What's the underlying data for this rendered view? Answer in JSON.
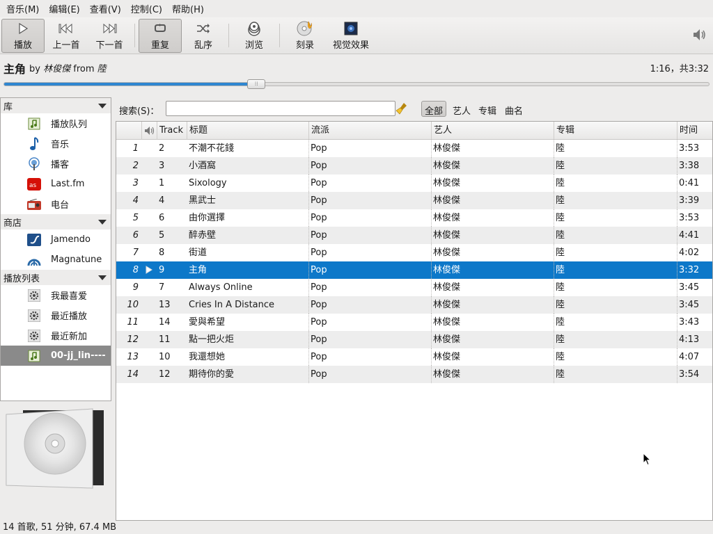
{
  "menu": [
    "音乐(M)",
    "编辑(E)",
    "查看(V)",
    "控制(C)",
    "帮助(H)"
  ],
  "toolbar": {
    "play": "播放",
    "prev": "上一首",
    "next": "下一首",
    "repeat": "重复",
    "shuffle": "乱序",
    "browse": "浏览",
    "burn": "刻录",
    "visual": "视觉效果"
  },
  "now_playing": {
    "title": "主角",
    "by_word": "by",
    "artist": "林俊傑",
    "from_word": "from",
    "album": "陸",
    "time": "1:16，共3:32",
    "progress_fraction": 0.358
  },
  "sidebar": {
    "sections": [
      {
        "header": "库",
        "items": [
          {
            "label": "播放队列",
            "icon": "play-queue-icon"
          },
          {
            "label": "音乐",
            "icon": "music-note-icon"
          },
          {
            "label": "播客",
            "icon": "podcast-icon"
          },
          {
            "label": "Last.fm",
            "icon": "lastfm-icon"
          },
          {
            "label": "电台",
            "icon": "radio-icon"
          }
        ]
      },
      {
        "header": "商店",
        "items": [
          {
            "label": "Jamendo",
            "icon": "jamendo-icon"
          },
          {
            "label": "Magnatune",
            "icon": "magnatune-icon"
          }
        ]
      },
      {
        "header": "播放列表",
        "items": [
          {
            "label": "我最喜爱",
            "icon": "gear-icon"
          },
          {
            "label": "最近播放",
            "icon": "gear-icon"
          },
          {
            "label": "最近新加",
            "icon": "gear-icon"
          },
          {
            "label": "00-jj_lin----",
            "icon": "playlist-icon",
            "selected": true
          }
        ]
      }
    ]
  },
  "search": {
    "label": "搜索(S)：",
    "value": "",
    "filters": [
      "全部",
      "艺人",
      "专辑",
      "曲名"
    ],
    "active_filter": "全部"
  },
  "table": {
    "columns": [
      "Track",
      "标题",
      "流派",
      "艺人",
      "专辑",
      "时间"
    ],
    "playing_index": 7,
    "rows": [
      {
        "n": "1",
        "track": "2",
        "title": "不潮不花錢",
        "genre": "Pop",
        "artist": "林俊傑",
        "album": "陸",
        "time": "3:53"
      },
      {
        "n": "2",
        "track": "3",
        "title": "小酒窩",
        "genre": "Pop",
        "artist": "林俊傑",
        "album": "陸",
        "time": "3:38"
      },
      {
        "n": "3",
        "track": "1",
        "title": "Sixology",
        "genre": "Pop",
        "artist": "林俊傑",
        "album": "陸",
        "time": "0:41"
      },
      {
        "n": "4",
        "track": "4",
        "title": "黑武士",
        "genre": "Pop",
        "artist": "林俊傑",
        "album": "陸",
        "time": "3:39"
      },
      {
        "n": "5",
        "track": "6",
        "title": "由你選擇",
        "genre": "Pop",
        "artist": "林俊傑",
        "album": "陸",
        "time": "3:53"
      },
      {
        "n": "6",
        "track": "5",
        "title": "醉赤壁",
        "genre": "Pop",
        "artist": "林俊傑",
        "album": "陸",
        "time": "4:41"
      },
      {
        "n": "7",
        "track": "8",
        "title": "街道",
        "genre": "Pop",
        "artist": "林俊傑",
        "album": "陸",
        "time": "4:02"
      },
      {
        "n": "8",
        "track": "9",
        "title": "主角",
        "genre": "Pop",
        "artist": "林俊傑",
        "album": "陸",
        "time": "3:32"
      },
      {
        "n": "9",
        "track": "7",
        "title": "Always Online",
        "genre": "Pop",
        "artist": "林俊傑",
        "album": "陸",
        "time": "3:45"
      },
      {
        "n": "10",
        "track": "13",
        "title": "Cries In A Distance",
        "genre": "Pop",
        "artist": "林俊傑",
        "album": "陸",
        "time": "3:45"
      },
      {
        "n": "11",
        "track": "14",
        "title": "愛與希望",
        "genre": "Pop",
        "artist": "林俊傑",
        "album": "陸",
        "time": "3:43"
      },
      {
        "n": "12",
        "track": "11",
        "title": "點一把火炬",
        "genre": "Pop",
        "artist": "林俊傑",
        "album": "陸",
        "time": "4:13"
      },
      {
        "n": "13",
        "track": "10",
        "title": "我還想她",
        "genre": "Pop",
        "artist": "林俊傑",
        "album": "陸",
        "time": "4:07"
      },
      {
        "n": "14",
        "track": "12",
        "title": "期待你的愛",
        "genre": "Pop",
        "artist": "林俊傑",
        "album": "陸",
        "time": "3:54"
      }
    ]
  },
  "status": "14 首歌, 51 分钟, 67.4 MB",
  "colors": {
    "accent": "#0d78c9",
    "progress": "#2f86d0",
    "selected_source": "#8a8a8a"
  }
}
